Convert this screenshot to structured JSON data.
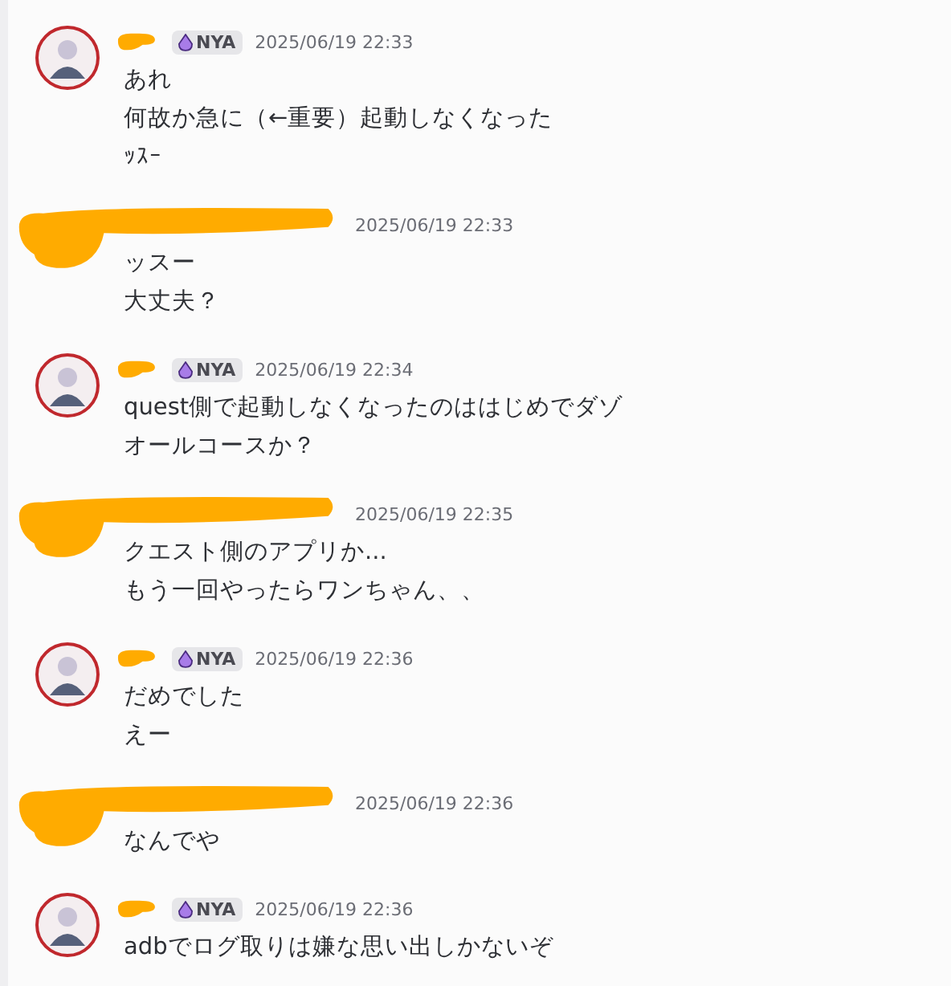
{
  "messages": [
    {
      "kind": "badge",
      "badge": "NYA",
      "time": "2025/06/19 22:33",
      "lines": [
        "あれ",
        "何故か急に（←重要）起動しなくなった",
        "ｯｽｰ"
      ]
    },
    {
      "kind": "plain",
      "time": "2025/06/19 22:33",
      "lines": [
        "ッスー",
        "大丈夫？"
      ]
    },
    {
      "kind": "badge",
      "badge": "NYA",
      "time": "2025/06/19 22:34",
      "lines": [
        "quest側で起動しなくなったのははじめでダゾ",
        "オールコースか？"
      ]
    },
    {
      "kind": "plain",
      "time": "2025/06/19 22:35",
      "lines": [
        "クエスト側のアプリか...",
        "もう一回やったらワンちゃん、、"
      ]
    },
    {
      "kind": "badge",
      "badge": "NYA",
      "time": "2025/06/19 22:36",
      "lines": [
        "だめでした",
        "えー"
      ]
    },
    {
      "kind": "plain",
      "time": "2025/06/19 22:36",
      "lines": [
        "なんでや"
      ]
    },
    {
      "kind": "badge",
      "badge": "NYA",
      "time": "2025/06/19 22:36",
      "lines": [
        "adbでログ取りは嫌な思い出しかないぞ"
      ]
    }
  ]
}
